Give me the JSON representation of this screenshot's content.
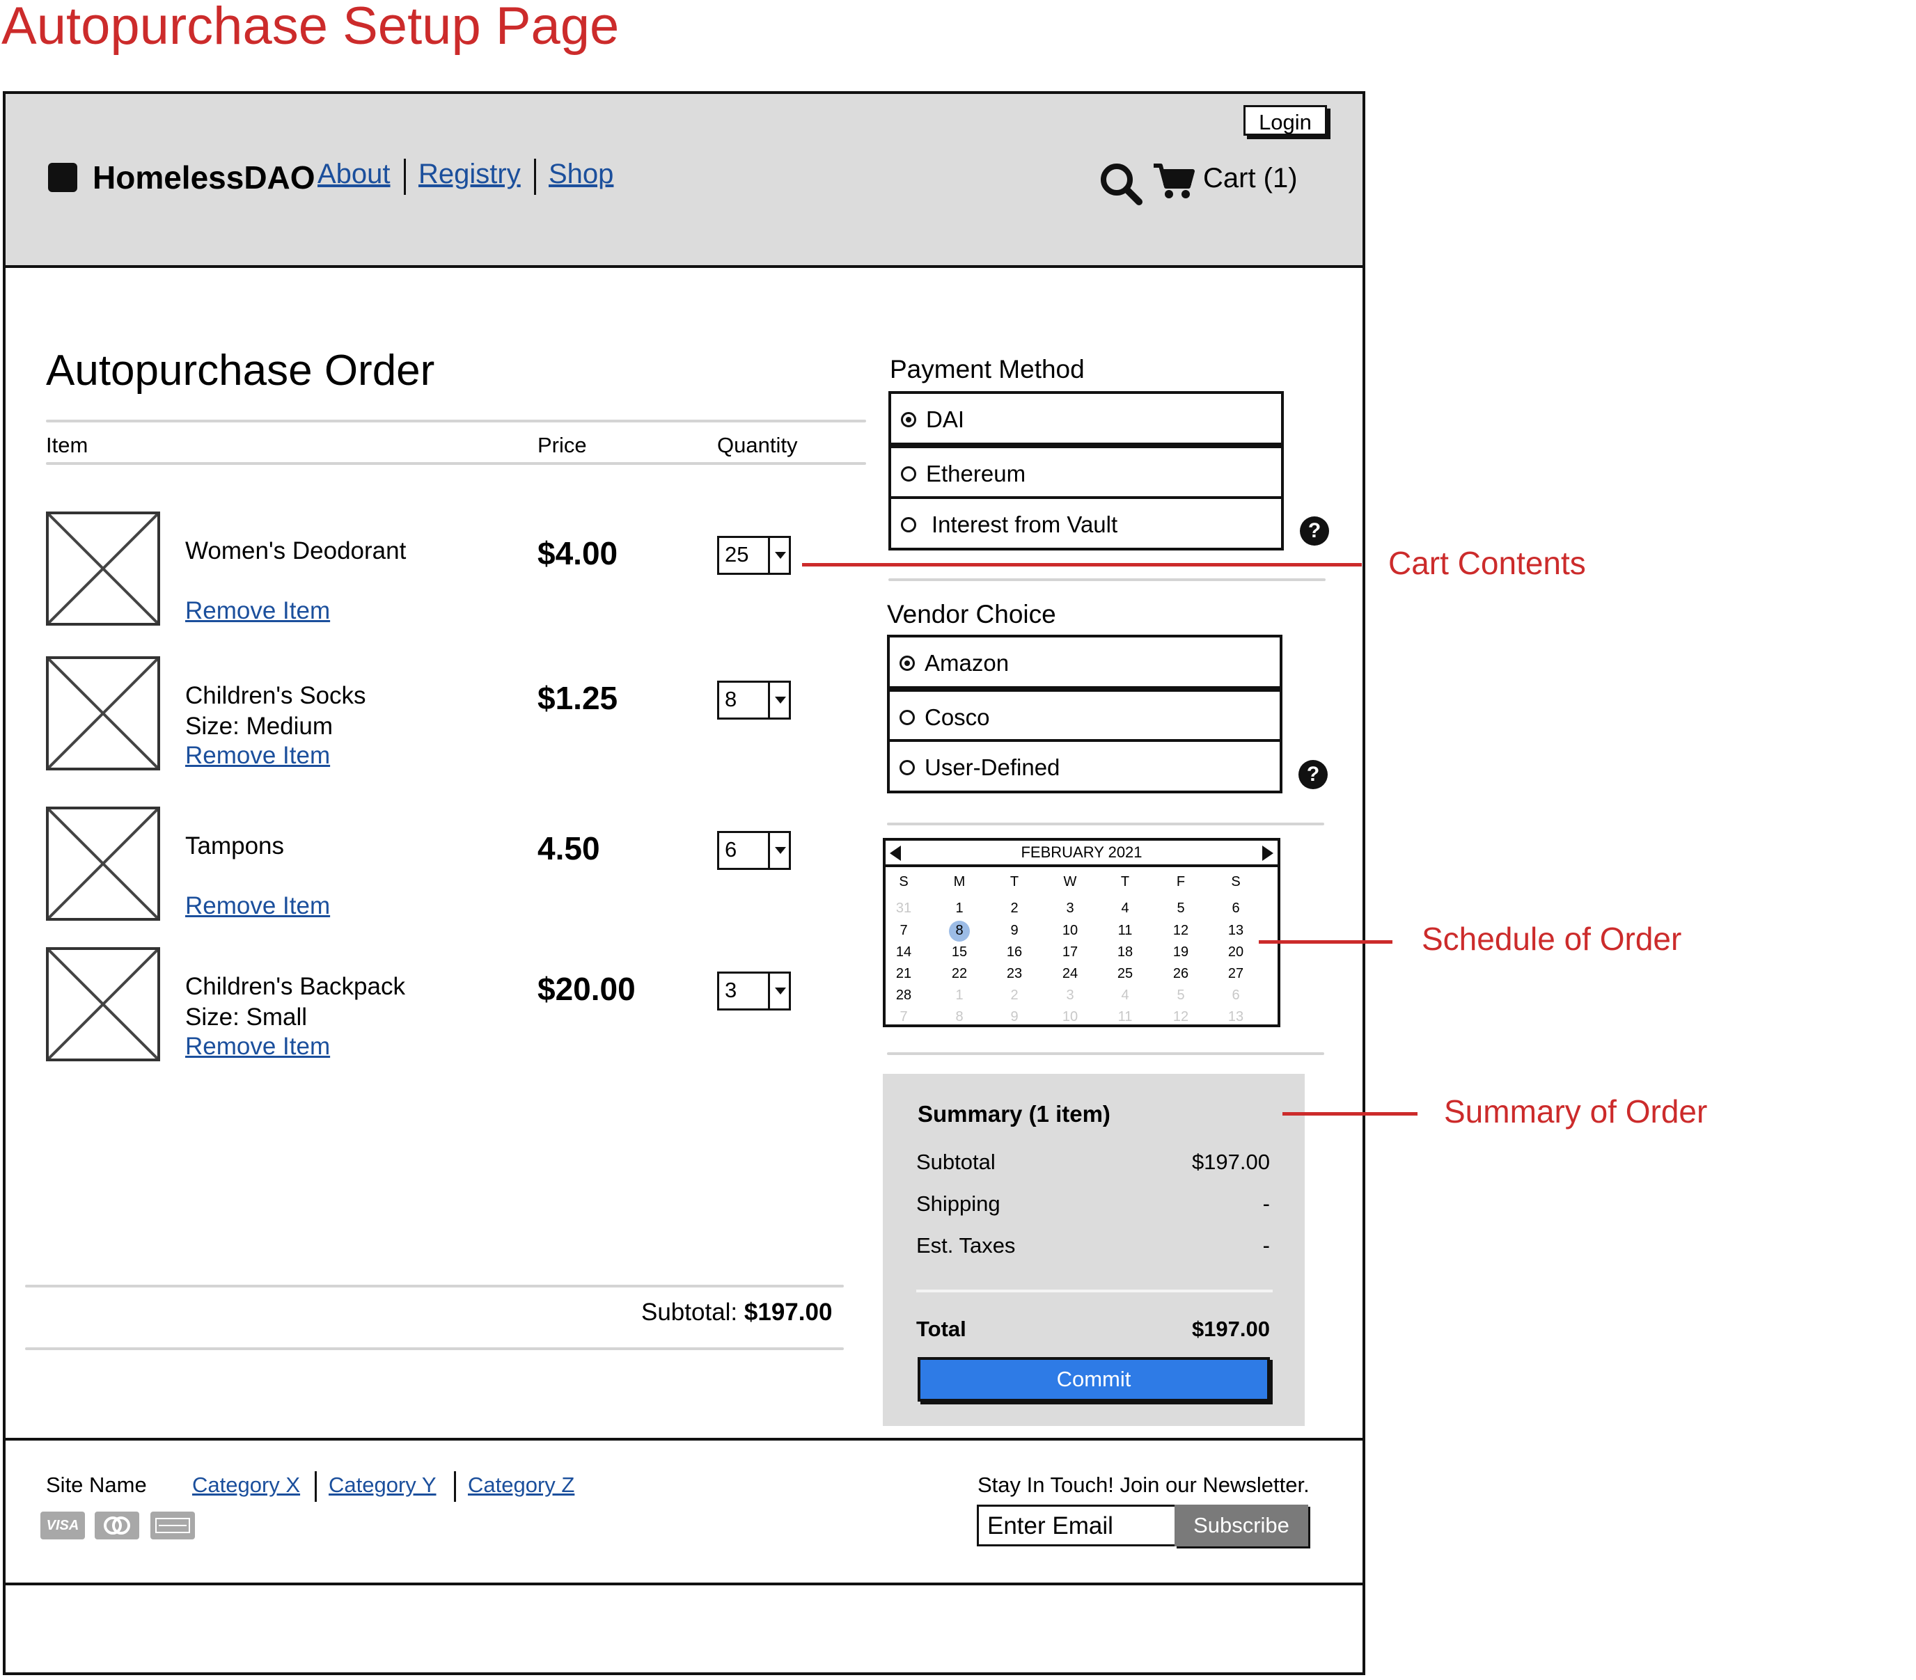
{
  "page_title": "Autopurchase Setup Page",
  "header": {
    "login_label": "Login",
    "brand": "HomelessDAO",
    "nav": [
      "About",
      "Registry",
      "Shop"
    ],
    "cart_label": "Cart (1)"
  },
  "order": {
    "title": "Autopurchase Order",
    "columns": {
      "item": "Item",
      "price": "Price",
      "quantity": "Quantity"
    },
    "items": [
      {
        "name": "Women's Deodorant",
        "detail": "",
        "price": "$4.00",
        "qty": "25",
        "remove": "Remove Item"
      },
      {
        "name": "Children's Socks",
        "detail": "Size: Medium",
        "price": "$1.25",
        "qty": "8",
        "remove": "Remove Item"
      },
      {
        "name": "Tampons",
        "detail": "",
        "price": "4.50",
        "qty": "6",
        "remove": "Remove Item"
      },
      {
        "name": "Children's Backpack",
        "detail": "Size: Small",
        "price": "$20.00",
        "qty": "3",
        "remove": "Remove Item"
      }
    ],
    "subtotal_label": "Subtotal:",
    "subtotal_value": "$197.00"
  },
  "payment": {
    "label": "Payment Method",
    "options": [
      "DAI",
      "Ethereum",
      "Interest from Vault"
    ],
    "selected": "DAI"
  },
  "vendor": {
    "label": "Vendor Choice",
    "options": [
      "Amazon",
      "Cosco",
      "User-Defined"
    ],
    "selected": "Amazon"
  },
  "help_glyph": "?",
  "calendar": {
    "month": "FEBRUARY 2021",
    "weekdays": [
      "S",
      "M",
      "T",
      "W",
      "T",
      "F",
      "S"
    ],
    "weeks": [
      [
        "31",
        "1",
        "2",
        "3",
        "4",
        "5",
        "6"
      ],
      [
        "7",
        "8",
        "9",
        "10",
        "11",
        "12",
        "13"
      ],
      [
        "14",
        "15",
        "16",
        "17",
        "18",
        "19",
        "20"
      ],
      [
        "21",
        "22",
        "23",
        "24",
        "25",
        "26",
        "27"
      ],
      [
        "28",
        "1",
        "2",
        "3",
        "4",
        "5",
        "6"
      ],
      [
        "7",
        "8",
        "9",
        "10",
        "11",
        "12",
        "13"
      ]
    ],
    "selected_day": "8"
  },
  "summary": {
    "title": "Summary (1 item)",
    "rows": [
      {
        "label": "Subtotal",
        "value": "$197.00"
      },
      {
        "label": "Shipping",
        "value": "-"
      },
      {
        "label": "Est. Taxes",
        "value": "-"
      }
    ],
    "total_label": "Total",
    "total_value": "$197.00",
    "commit_label": "Commit"
  },
  "annotations": {
    "cart": "Cart Contents",
    "schedule": "Schedule of Order",
    "summary": "Summary of Order",
    "color": "#cc2b2b"
  },
  "footer": {
    "site_name": "Site Name",
    "categories": [
      "Category X",
      "Category Y",
      "Category Z"
    ],
    "cards": [
      "VISA",
      "mastercard",
      "american-express"
    ],
    "newsletter": "Stay In Touch! Join our Newsletter.",
    "email_placeholder": "Enter Email",
    "subscribe_label": "Subscribe"
  },
  "colors": {
    "primary_button": "#2e7be6",
    "link": "#1b4f9c",
    "header_bg": "#dcdcdc"
  }
}
